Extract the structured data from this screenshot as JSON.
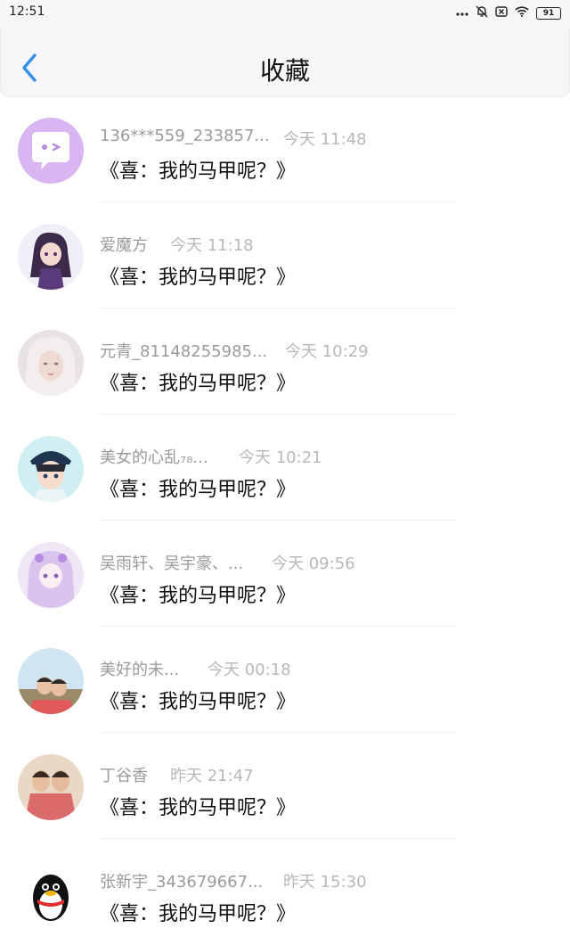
{
  "status_bar": {
    "time": "12:51",
    "battery": "91",
    "icons": [
      "more-dots-icon",
      "mute-bell-icon",
      "notification-x-icon",
      "wifi-icon",
      "battery-icon"
    ]
  },
  "header": {
    "title": "收藏",
    "back_icon": "chevron-left-icon",
    "accent_color": "#2f8fe6"
  },
  "items": [
    {
      "name": "136***559_233857...",
      "time": "今天 11:48",
      "title": "《喜：我的马甲呢？》",
      "avatar": "chat-bubble-avatar"
    },
    {
      "name": "爱魔方",
      "time": "今天 11:18",
      "title": "《喜：我的马甲呢？》",
      "avatar": "anime-girl-avatar"
    },
    {
      "name": "元青_81148255985...",
      "time": "今天 10:29",
      "title": "《喜：我的马甲呢？》",
      "avatar": "doll-avatar"
    },
    {
      "name": "美女的心乱₇₈...",
      "time": "今天 10:21",
      "title": "《喜：我的马甲呢？》",
      "avatar": "anime-boy-cap-avatar"
    },
    {
      "name": "吴雨轩、吴宇豪、...",
      "time": "今天 09:56",
      "title": "《喜：我的马甲呢？》",
      "avatar": "anime-purple-girl-avatar"
    },
    {
      "name": "美好的未...",
      "time": "今天 00:18",
      "title": "《喜：我的马甲呢？》",
      "avatar": "kids-photo-avatar"
    },
    {
      "name": "丁谷香",
      "time": "昨天 21:47",
      "title": "《喜：我的马甲呢？》",
      "avatar": "family-photo-avatar"
    },
    {
      "name": "张新宇_343679667...",
      "time": "昨天 15:30",
      "title": "《喜：我的马甲呢？》",
      "avatar": "penguin-avatar"
    }
  ]
}
